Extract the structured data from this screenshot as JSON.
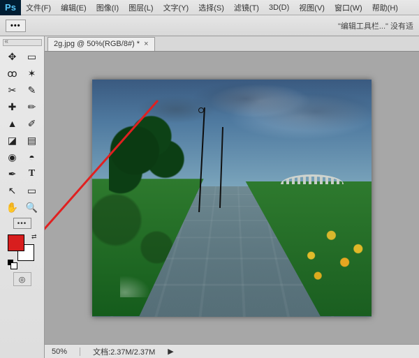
{
  "app": {
    "logo": "Ps"
  },
  "menu": {
    "items": [
      "文件(F)",
      "编辑(E)",
      "图像(I)",
      "图层(L)",
      "文字(Y)",
      "选择(S)",
      "滤镜(T)",
      "3D(D)",
      "视图(V)",
      "窗口(W)",
      "帮助(H)"
    ]
  },
  "optionbar": {
    "dots": "•••",
    "hint_prefix": "\"",
    "hint_text": "编辑工具栏...",
    "hint_suffix": "\" 没有适"
  },
  "tools": {
    "row": [
      {
        "name": "move-tool",
        "glyph": "✥"
      },
      {
        "name": "marquee-tool",
        "glyph": "▭"
      },
      {
        "name": "lasso-tool",
        "glyph": "ꝏ"
      },
      {
        "name": "quickselect-tool",
        "glyph": "✶"
      },
      {
        "name": "crop-tool",
        "glyph": "✂"
      },
      {
        "name": "eyedropper-tool",
        "glyph": "✎"
      },
      {
        "name": "healing-tool",
        "glyph": "✚"
      },
      {
        "name": "brush-tool",
        "glyph": "✏"
      },
      {
        "name": "stamp-tool",
        "glyph": "▲"
      },
      {
        "name": "history-brush-tool",
        "glyph": "✐"
      },
      {
        "name": "eraser-tool",
        "glyph": "◪"
      },
      {
        "name": "gradient-tool",
        "glyph": "▤"
      },
      {
        "name": "blur-tool",
        "glyph": "◉"
      },
      {
        "name": "dodge-tool",
        "glyph": "◓"
      },
      {
        "name": "pen-tool",
        "glyph": "✒"
      },
      {
        "name": "type-tool",
        "glyph": "T"
      },
      {
        "name": "path-tool",
        "glyph": "↖"
      },
      {
        "name": "shape-tool",
        "glyph": "▭"
      },
      {
        "name": "hand-tool",
        "glyph": "✋"
      },
      {
        "name": "zoom-tool",
        "glyph": "🔍"
      }
    ],
    "dots": "•••",
    "quickmask": "◎"
  },
  "colors": {
    "foreground": "#d81e1e",
    "background": "#ffffff"
  },
  "document": {
    "tab_label": "2g.jpg @ 50%(RGB/8#) *",
    "tab_close": "×"
  },
  "status": {
    "zoom": "50%",
    "doc_label": "文档:",
    "doc_value": "2.37M/2.37M",
    "more": "▶"
  },
  "annotation": {
    "arrow_color": "#e02020"
  }
}
